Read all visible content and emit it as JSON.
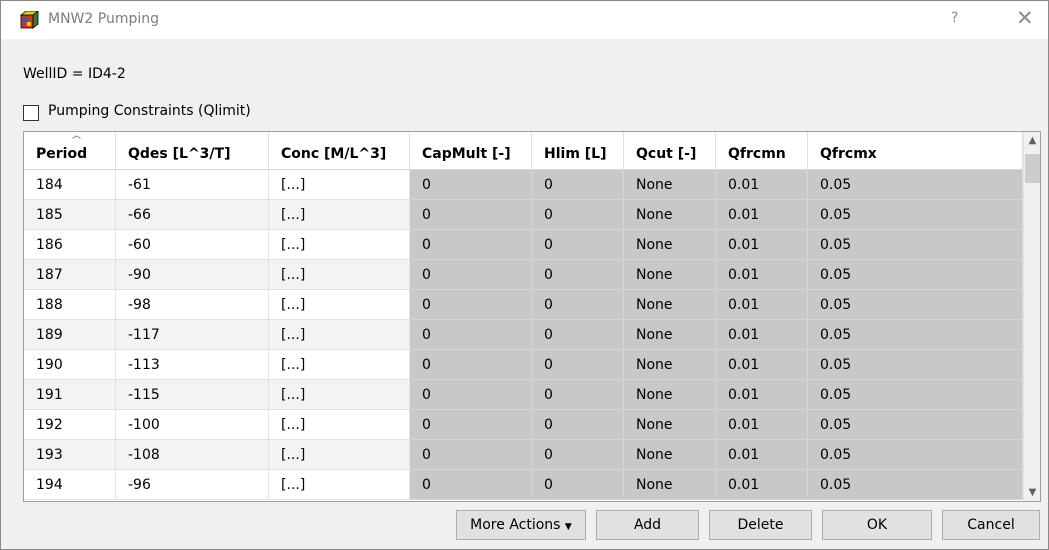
{
  "window": {
    "title": "MNW2 Pumping",
    "help_label": "?",
    "close_label": "✕"
  },
  "well": {
    "id_text": "WellID = ID4-2"
  },
  "constraints": {
    "label": "Pumping Constraints (Qlimit)",
    "checked": false
  },
  "grid": {
    "columns": [
      "Period",
      "Qdes [L^3/T]",
      "Conc [M/L^3]",
      "CapMult [-]",
      "Hlim [L]",
      "Qcut [-]",
      "Qfrcmn",
      "Qfrcmx"
    ],
    "sort_indicator": "^",
    "rows": [
      [
        "184",
        "-61",
        "[...]",
        "0",
        "0",
        "None",
        "0.01",
        "0.05"
      ],
      [
        "185",
        "-66",
        "[...]",
        "0",
        "0",
        "None",
        "0.01",
        "0.05"
      ],
      [
        "186",
        "-60",
        "[...]",
        "0",
        "0",
        "None",
        "0.01",
        "0.05"
      ],
      [
        "187",
        "-90",
        "[...]",
        "0",
        "0",
        "None",
        "0.01",
        "0.05"
      ],
      [
        "188",
        "-98",
        "[...]",
        "0",
        "0",
        "None",
        "0.01",
        "0.05"
      ],
      [
        "189",
        "-117",
        "[...]",
        "0",
        "0",
        "None",
        "0.01",
        "0.05"
      ],
      [
        "190",
        "-113",
        "[...]",
        "0",
        "0",
        "None",
        "0.01",
        "0.05"
      ],
      [
        "191",
        "-115",
        "[...]",
        "0",
        "0",
        "None",
        "0.01",
        "0.05"
      ],
      [
        "192",
        "-100",
        "[...]",
        "0",
        "0",
        "None",
        "0.01",
        "0.05"
      ],
      [
        "193",
        "-108",
        "[...]",
        "0",
        "0",
        "None",
        "0.01",
        "0.05"
      ],
      [
        "194",
        "-96",
        "[...]",
        "0",
        "0",
        "None",
        "0.01",
        "0.05"
      ]
    ]
  },
  "buttons": {
    "more_actions": "More Actions",
    "add": "Add",
    "delete": "Delete",
    "ok": "OK",
    "cancel": "Cancel"
  },
  "colors": {
    "readonly_cell": "#c8c8c8",
    "alt_row": "#f3f3f3"
  },
  "icons": {
    "app": "app-cube-icon",
    "dropdown": "caret-down-icon",
    "scroll_up": "chevron-up-icon",
    "scroll_down": "chevron-down-icon"
  }
}
